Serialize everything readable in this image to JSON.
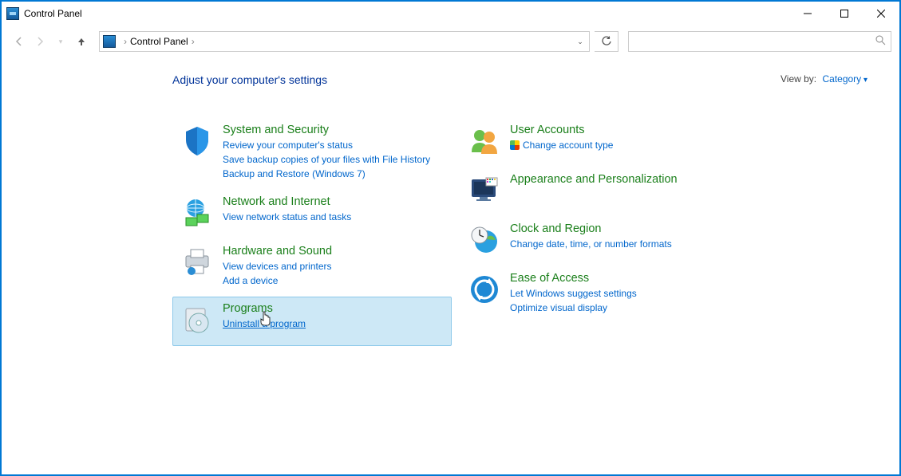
{
  "window": {
    "title": "Control Panel"
  },
  "breadcrumb": {
    "root": "Control Panel"
  },
  "heading": "Adjust your computer's settings",
  "viewby": {
    "label": "View by:",
    "value": "Category"
  },
  "left": [
    {
      "title": "System and Security",
      "links": [
        "Review your computer's status",
        "Save backup copies of your files with File History",
        "Backup and Restore (Windows 7)"
      ]
    },
    {
      "title": "Network and Internet",
      "links": [
        "View network status and tasks"
      ]
    },
    {
      "title": "Hardware and Sound",
      "links": [
        "View devices and printers",
        "Add a device"
      ]
    },
    {
      "title": "Programs",
      "links": [
        "Uninstall a program"
      ]
    }
  ],
  "right": [
    {
      "title": "User Accounts",
      "links": [
        "Change account type"
      ],
      "shield": true
    },
    {
      "title": "Appearance and Personalization",
      "links": []
    },
    {
      "title": "Clock and Region",
      "links": [
        "Change date, time, or number formats"
      ]
    },
    {
      "title": "Ease of Access",
      "links": [
        "Let Windows suggest settings",
        "Optimize visual display"
      ]
    }
  ]
}
